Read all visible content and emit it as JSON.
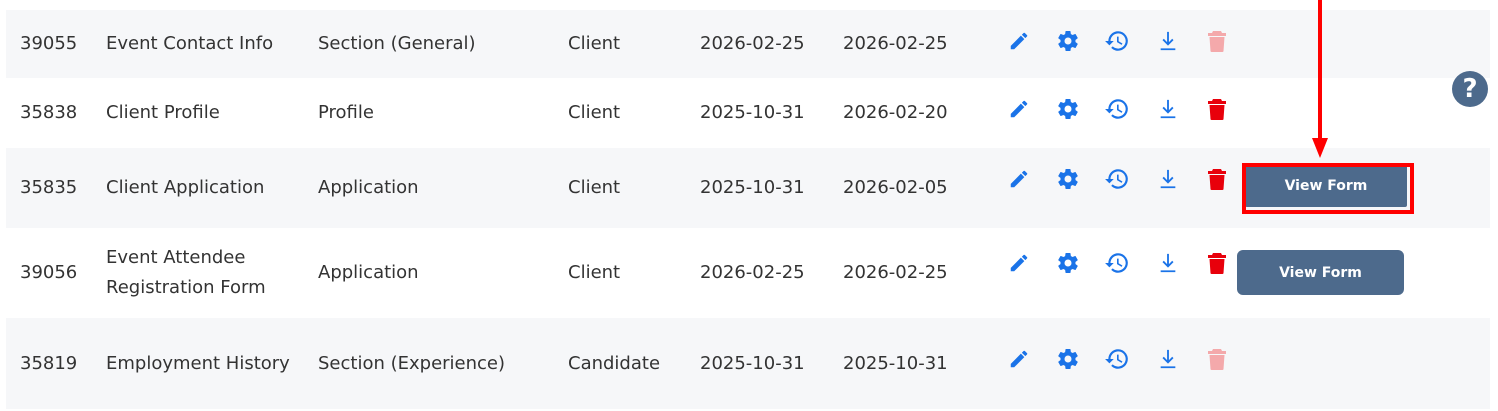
{
  "rows": [
    {
      "id": "39055",
      "name": "Event Contact Info",
      "type": "Section (General)",
      "audience": "Client",
      "created": "2026-02-25",
      "updated": "2026-02-25",
      "delete_enabled": false,
      "view_form": ""
    },
    {
      "id": "35838",
      "name": "Client Profile",
      "type": "Profile",
      "audience": "Client",
      "created": "2025-10-31",
      "updated": "2026-02-20",
      "delete_enabled": true,
      "view_form": ""
    },
    {
      "id": "35835",
      "name": "Client Application",
      "type": "Application",
      "audience": "Client",
      "created": "2025-10-31",
      "updated": "2026-02-05",
      "delete_enabled": true,
      "view_form": "View Form"
    },
    {
      "id": "39056",
      "name": "Event Attendee Registration Form",
      "type": "Application",
      "audience": "Client",
      "created": "2026-02-25",
      "updated": "2026-02-25",
      "delete_enabled": true,
      "view_form": "View Form"
    },
    {
      "id": "35819",
      "name": "Employment History",
      "type": "Section (Experience)",
      "audience": "Candidate",
      "created": "2025-10-31",
      "updated": "2025-10-31",
      "delete_enabled": false,
      "view_form": ""
    }
  ],
  "icons": {
    "edit": "pencil-icon",
    "settings": "gear-icon",
    "history": "history-icon",
    "download": "download-icon",
    "delete": "trash-icon",
    "help": "question-icon"
  },
  "help_label": "?",
  "colors": {
    "icon_blue": "#1a73e8",
    "delete_red": "#e8000b",
    "delete_disabled": "#f4a9ab",
    "button_bg": "#4d6a8c",
    "highlight_red": "#ff0000",
    "row_shade": "#f6f7f9"
  }
}
